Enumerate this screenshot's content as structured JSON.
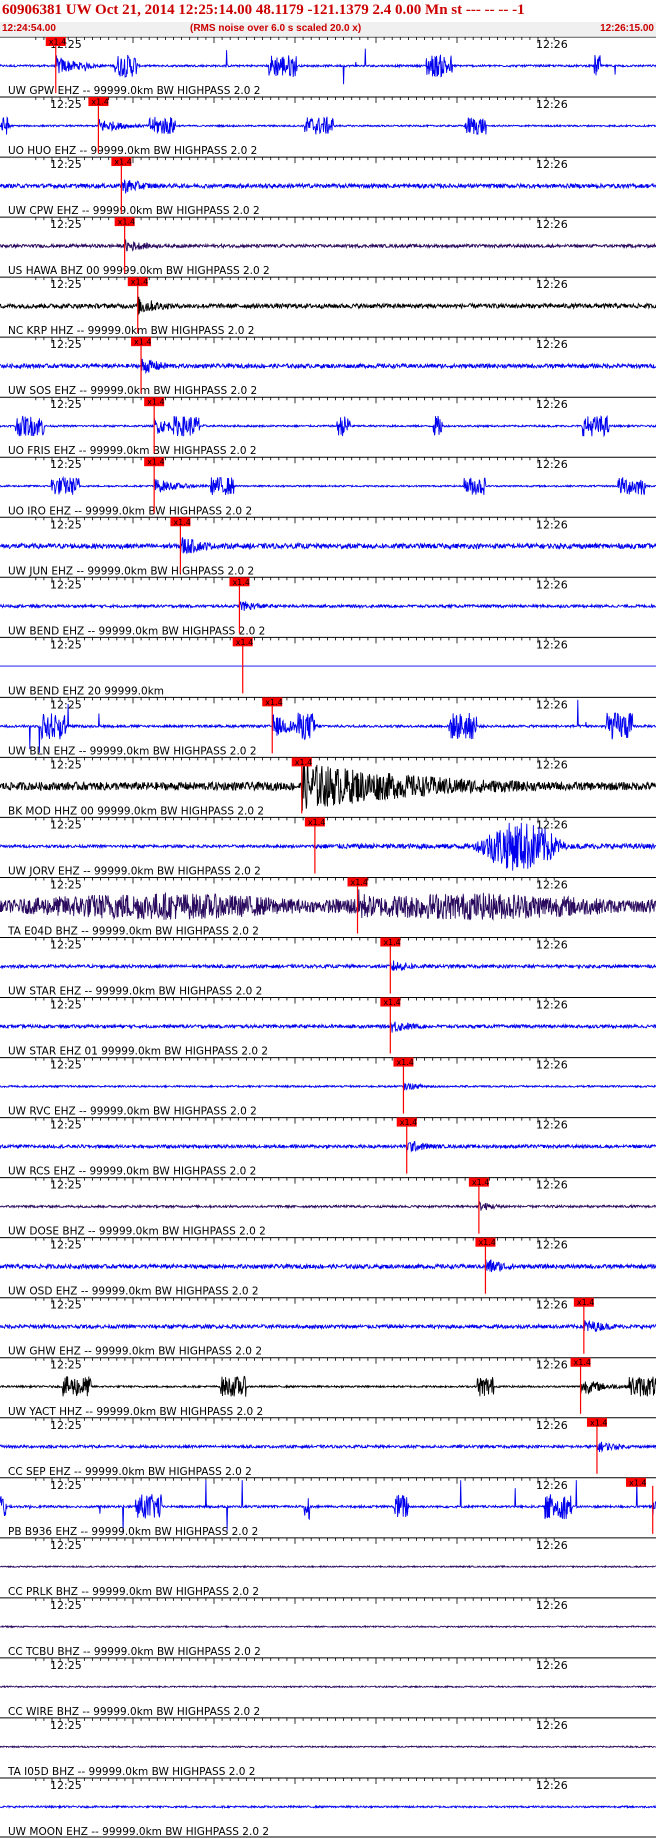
{
  "header": {
    "title": "60906381 UW Oct 21, 2014 12:25:14.00   48.1179 -121.1379  2.4 0.00 Mn st --- -- --   -1",
    "start_time": "12:24:54.00",
    "note": "(RMS noise over 6.0 s scaled 20.0 x)",
    "end_time": "12:26:15.00"
  },
  "colors": {
    "trace_blue": "#0000ee",
    "trace_black": "#000000",
    "trace_purple": "#2a0a5e",
    "pick_red": "#ff0000",
    "header_red": "#cc0000"
  },
  "chart_data": {
    "type": "seismogram",
    "time_range": [
      "12:24:54.00",
      "12:26:15.00"
    ],
    "time_ticks": [
      "12:25",
      "12:26"
    ],
    "pick_label": "x1.4",
    "traces": [
      {
        "label": "UW GPW EHZ -- 99999.0km BW  HIGHPASS  2.0  2",
        "color": "blue",
        "style": "spiky",
        "pick_frac": 0.085,
        "amp": 0.5
      },
      {
        "label": "UO HUO EHZ -- 99999.0km BW  HIGHPASS  2.0  2",
        "color": "blue",
        "style": "bursts",
        "pick_frac": 0.15,
        "amp": 0.4
      },
      {
        "label": "UW CPW EHZ -- 99999.0km BW  HIGHPASS  2.0  2",
        "color": "blue",
        "style": "noise",
        "pick_frac": 0.185,
        "amp": 0.45
      },
      {
        "label": "US HAWA BHZ 00 99999.0km BW  HIGHPASS  2.0  2",
        "color": "purple",
        "style": "noise",
        "pick_frac": 0.19,
        "amp": 0.35
      },
      {
        "label": "NC KRP HHZ -- 99999.0km BW  HIGHPASS  2.0  2",
        "color": "black",
        "style": "noise",
        "pick_frac": 0.21,
        "amp": 0.5
      },
      {
        "label": "UW SOS EHZ -- 99999.0km BW  HIGHPASS  2.0  2",
        "color": "blue",
        "style": "noise",
        "pick_frac": 0.215,
        "amp": 0.45
      },
      {
        "label": "UO FRIS EHZ -- 99999.0km BW  HIGHPASS  2.0  2",
        "color": "blue",
        "style": "bursts",
        "pick_frac": 0.235,
        "amp": 0.45
      },
      {
        "label": "UO IRO EHZ -- 99999.0km BW  HIGHPASS  2.0  2",
        "color": "blue",
        "style": "bursts",
        "pick_frac": 0.235,
        "amp": 0.4
      },
      {
        "label": "UW JUN EHZ -- 99999.0km BW  HIGHPASS  2.0  2",
        "color": "blue",
        "style": "noise",
        "pick_frac": 0.275,
        "amp": 0.55
      },
      {
        "label": "UW BEND EHZ -- 99999.0km BW  HIGHPASS  2.0  2",
        "color": "blue",
        "style": "noise",
        "pick_frac": 0.365,
        "amp": 0.3
      },
      {
        "label": "UW BEND EHZ 20 99999.0km",
        "color": "blue",
        "style": "flat",
        "pick_frac": 0.37,
        "amp": 0.02
      },
      {
        "label": "UW BLN EHZ -- 99999.0km BW  HIGHPASS  2.0  2",
        "color": "blue",
        "style": "spiky",
        "pick_frac": 0.415,
        "amp": 0.6
      },
      {
        "label": "BK MOD HHZ 00 99999.0km BW  HIGHPASS  2.0  2",
        "color": "black",
        "style": "event",
        "pick_frac": 0.46,
        "amp": 0.9
      },
      {
        "label": "UW JORV EHZ -- 99999.0km BW  HIGHPASS  2.0  2",
        "color": "blue",
        "style": "blob",
        "pick_frac": 0.48,
        "amp": 0.3
      },
      {
        "label": "TA E04D BHZ -- 99999.0km BW  HIGHPASS  2.0  2",
        "color": "purple",
        "style": "dense",
        "pick_frac": 0.545,
        "amp": 0.9
      },
      {
        "label": "UW STAR EHZ -- 99999.0km BW  HIGHPASS  2.0  2",
        "color": "blue",
        "style": "noise",
        "pick_frac": 0.595,
        "amp": 0.35
      },
      {
        "label": "UW STAR EHZ 01 99999.0km BW  HIGHPASS  2.0  2",
        "color": "blue",
        "style": "noise",
        "pick_frac": 0.595,
        "amp": 0.35
      },
      {
        "label": "UW RVC EHZ -- 99999.0km BW  HIGHPASS  2.0  2",
        "color": "blue",
        "style": "noise",
        "pick_frac": 0.615,
        "amp": 0.2
      },
      {
        "label": "UW RCS EHZ -- 99999.0km BW  HIGHPASS  2.0  2",
        "color": "blue",
        "style": "noise",
        "pick_frac": 0.62,
        "amp": 0.35
      },
      {
        "label": "UW DOSE BHZ -- 99999.0km BW  HIGHPASS  2.0  2",
        "color": "purple",
        "style": "noise",
        "pick_frac": 0.73,
        "amp": 0.25
      },
      {
        "label": "UW OSD EHZ -- 99999.0km BW  HIGHPASS  2.0  2",
        "color": "blue",
        "style": "noise",
        "pick_frac": 0.74,
        "amp": 0.45
      },
      {
        "label": "UW GHW EHZ -- 99999.0km BW  HIGHPASS  2.0  2",
        "color": "blue",
        "style": "noise",
        "pick_frac": 0.89,
        "amp": 0.4
      },
      {
        "label": "UW YACT HHZ -- 99999.0km BW  HIGHPASS  2.0  2",
        "color": "black",
        "style": "bursts",
        "pick_frac": 0.885,
        "amp": 0.45
      },
      {
        "label": "CC SEP EHZ -- 99999.0km BW  HIGHPASS  2.0  2",
        "color": "blue",
        "style": "noise",
        "pick_frac": 0.91,
        "amp": 0.3
      },
      {
        "label": "PB B936 EHZ -- 99999.0km BW  HIGHPASS  2.0  2",
        "color": "blue",
        "style": "spiky",
        "pick_frac": 0.995,
        "amp": 0.55
      },
      {
        "label": "CC PRLK BHZ -- 99999.0km BW  HIGHPASS  2.0  2",
        "color": "purple",
        "style": "noise",
        "pick_frac": null,
        "amp": 0.15
      },
      {
        "label": "CC TCBU BHZ -- 99999.0km BW  HIGHPASS  2.0  2",
        "color": "purple",
        "style": "noise",
        "pick_frac": null,
        "amp": 0.15
      },
      {
        "label": "CC WIRE BHZ -- 99999.0km BW  HIGHPASS  2.0  2",
        "color": "purple",
        "style": "noise",
        "pick_frac": null,
        "amp": 0.15
      },
      {
        "label": "TA I05D BHZ -- 99999.0km BW  HIGHPASS  2.0  2",
        "color": "purple",
        "style": "noise",
        "pick_frac": null,
        "amp": 0.15
      },
      {
        "label": "UW MOON EHZ -- 99999.0km BW  HIGHPASS  2.0  2",
        "color": "blue",
        "style": "noise",
        "pick_frac": null,
        "amp": 0.2
      }
    ]
  }
}
